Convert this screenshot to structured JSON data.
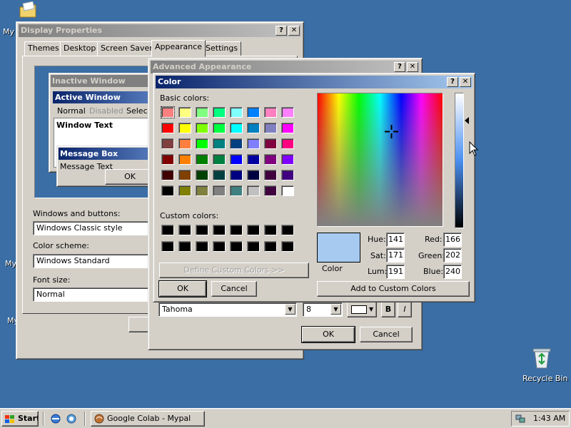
{
  "desktop": {
    "icons": [
      {
        "label": "My"
      },
      {
        "label": "My"
      },
      {
        "label": "My"
      },
      {
        "label": "Recycle Bin"
      }
    ]
  },
  "display_properties": {
    "title": "Display Properties",
    "tabs": [
      "Themes",
      "Desktop",
      "Screen Saver",
      "Appearance",
      "Settings"
    ],
    "preview": {
      "inactive_window": "Inactive Window",
      "active_window": "Active Window",
      "menu_normal": "Normal",
      "menu_disabled": "Disabled",
      "menu_selected": "Selecte",
      "window_text": "Window Text",
      "message_box": "Message Box",
      "message_text": "Message Text",
      "ok": "OK"
    },
    "windows_buttons_label": "Windows and buttons:",
    "windows_buttons_value": "Windows Classic style",
    "color_scheme_label": "Color scheme:",
    "color_scheme_value": "Windows Standard",
    "font_size_label": "Font size:",
    "font_size_value": "Normal"
  },
  "advanced_appearance": {
    "title": "Advanced Appearance",
    "font_value": "Tahoma",
    "size_value": "8",
    "bold_label": "B",
    "italic_label": "I",
    "ok": "OK",
    "cancel": "Cancel"
  },
  "color_dialog": {
    "title": "Color",
    "basic_colors_label": "Basic colors:",
    "basic_colors": [
      "#ff8080",
      "#ffff80",
      "#80ff80",
      "#00ff80",
      "#80ffff",
      "#0080ff",
      "#ff80c0",
      "#ff80ff",
      "#ff0000",
      "#ffff00",
      "#80ff00",
      "#00ff40",
      "#00ffff",
      "#0080c0",
      "#8080c0",
      "#ff00ff",
      "#804040",
      "#ff8040",
      "#00ff00",
      "#008080",
      "#004080",
      "#8080ff",
      "#800040",
      "#ff0080",
      "#800000",
      "#ff8000",
      "#008000",
      "#008040",
      "#0000ff",
      "#0000a0",
      "#800080",
      "#8000ff",
      "#400000",
      "#804000",
      "#004000",
      "#004040",
      "#000080",
      "#000040",
      "#400040",
      "#400080",
      "#000000",
      "#808000",
      "#808040",
      "#808080",
      "#408080",
      "#c0c0c0",
      "#400040",
      "#ffffff"
    ],
    "selected_index": 0,
    "custom_colors_label": "Custom colors:",
    "custom_colors": [
      "#000000",
      "#000000",
      "#000000",
      "#000000",
      "#000000",
      "#000000",
      "#000000",
      "#000000",
      "#000000",
      "#000000",
      "#000000",
      "#000000",
      "#000000",
      "#000000",
      "#000000",
      "#000000"
    ],
    "define_custom": "Define Custom Colors >>",
    "ok": "OK",
    "cancel": "Cancel",
    "color_solid_label": "Color",
    "preview_color": "#a6caf0",
    "hue_label": "Hue:",
    "hue": "141",
    "sat_label": "Sat:",
    "sat": "171",
    "lum_label": "Lum:",
    "lum": "191",
    "red_label": "Red:",
    "red": "166",
    "green_label": "Green:",
    "green": "202",
    "blue_label": "Blue:",
    "blue": "240",
    "add_custom": "Add to Custom Colors"
  },
  "taskbar": {
    "start": "Start",
    "task": "Google Colab - Mypal",
    "clock": "1:43 AM"
  }
}
